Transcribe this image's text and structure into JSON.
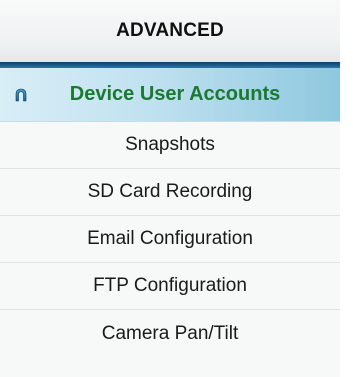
{
  "header": {
    "title": "ADVANCED"
  },
  "menu": {
    "items": [
      {
        "label": "Device User Accounts",
        "active": true,
        "icon": "lock-icon"
      },
      {
        "label": "Snapshots"
      },
      {
        "label": "SD Card Recording"
      },
      {
        "label": "Email Configuration"
      },
      {
        "label": "FTP Configuration"
      },
      {
        "label": "Camera Pan/Tilt"
      }
    ]
  },
  "colors": {
    "active_text": "#1a7a2f",
    "header_bar": "#1d5f8e",
    "active_bg": "#bfe1ef"
  }
}
